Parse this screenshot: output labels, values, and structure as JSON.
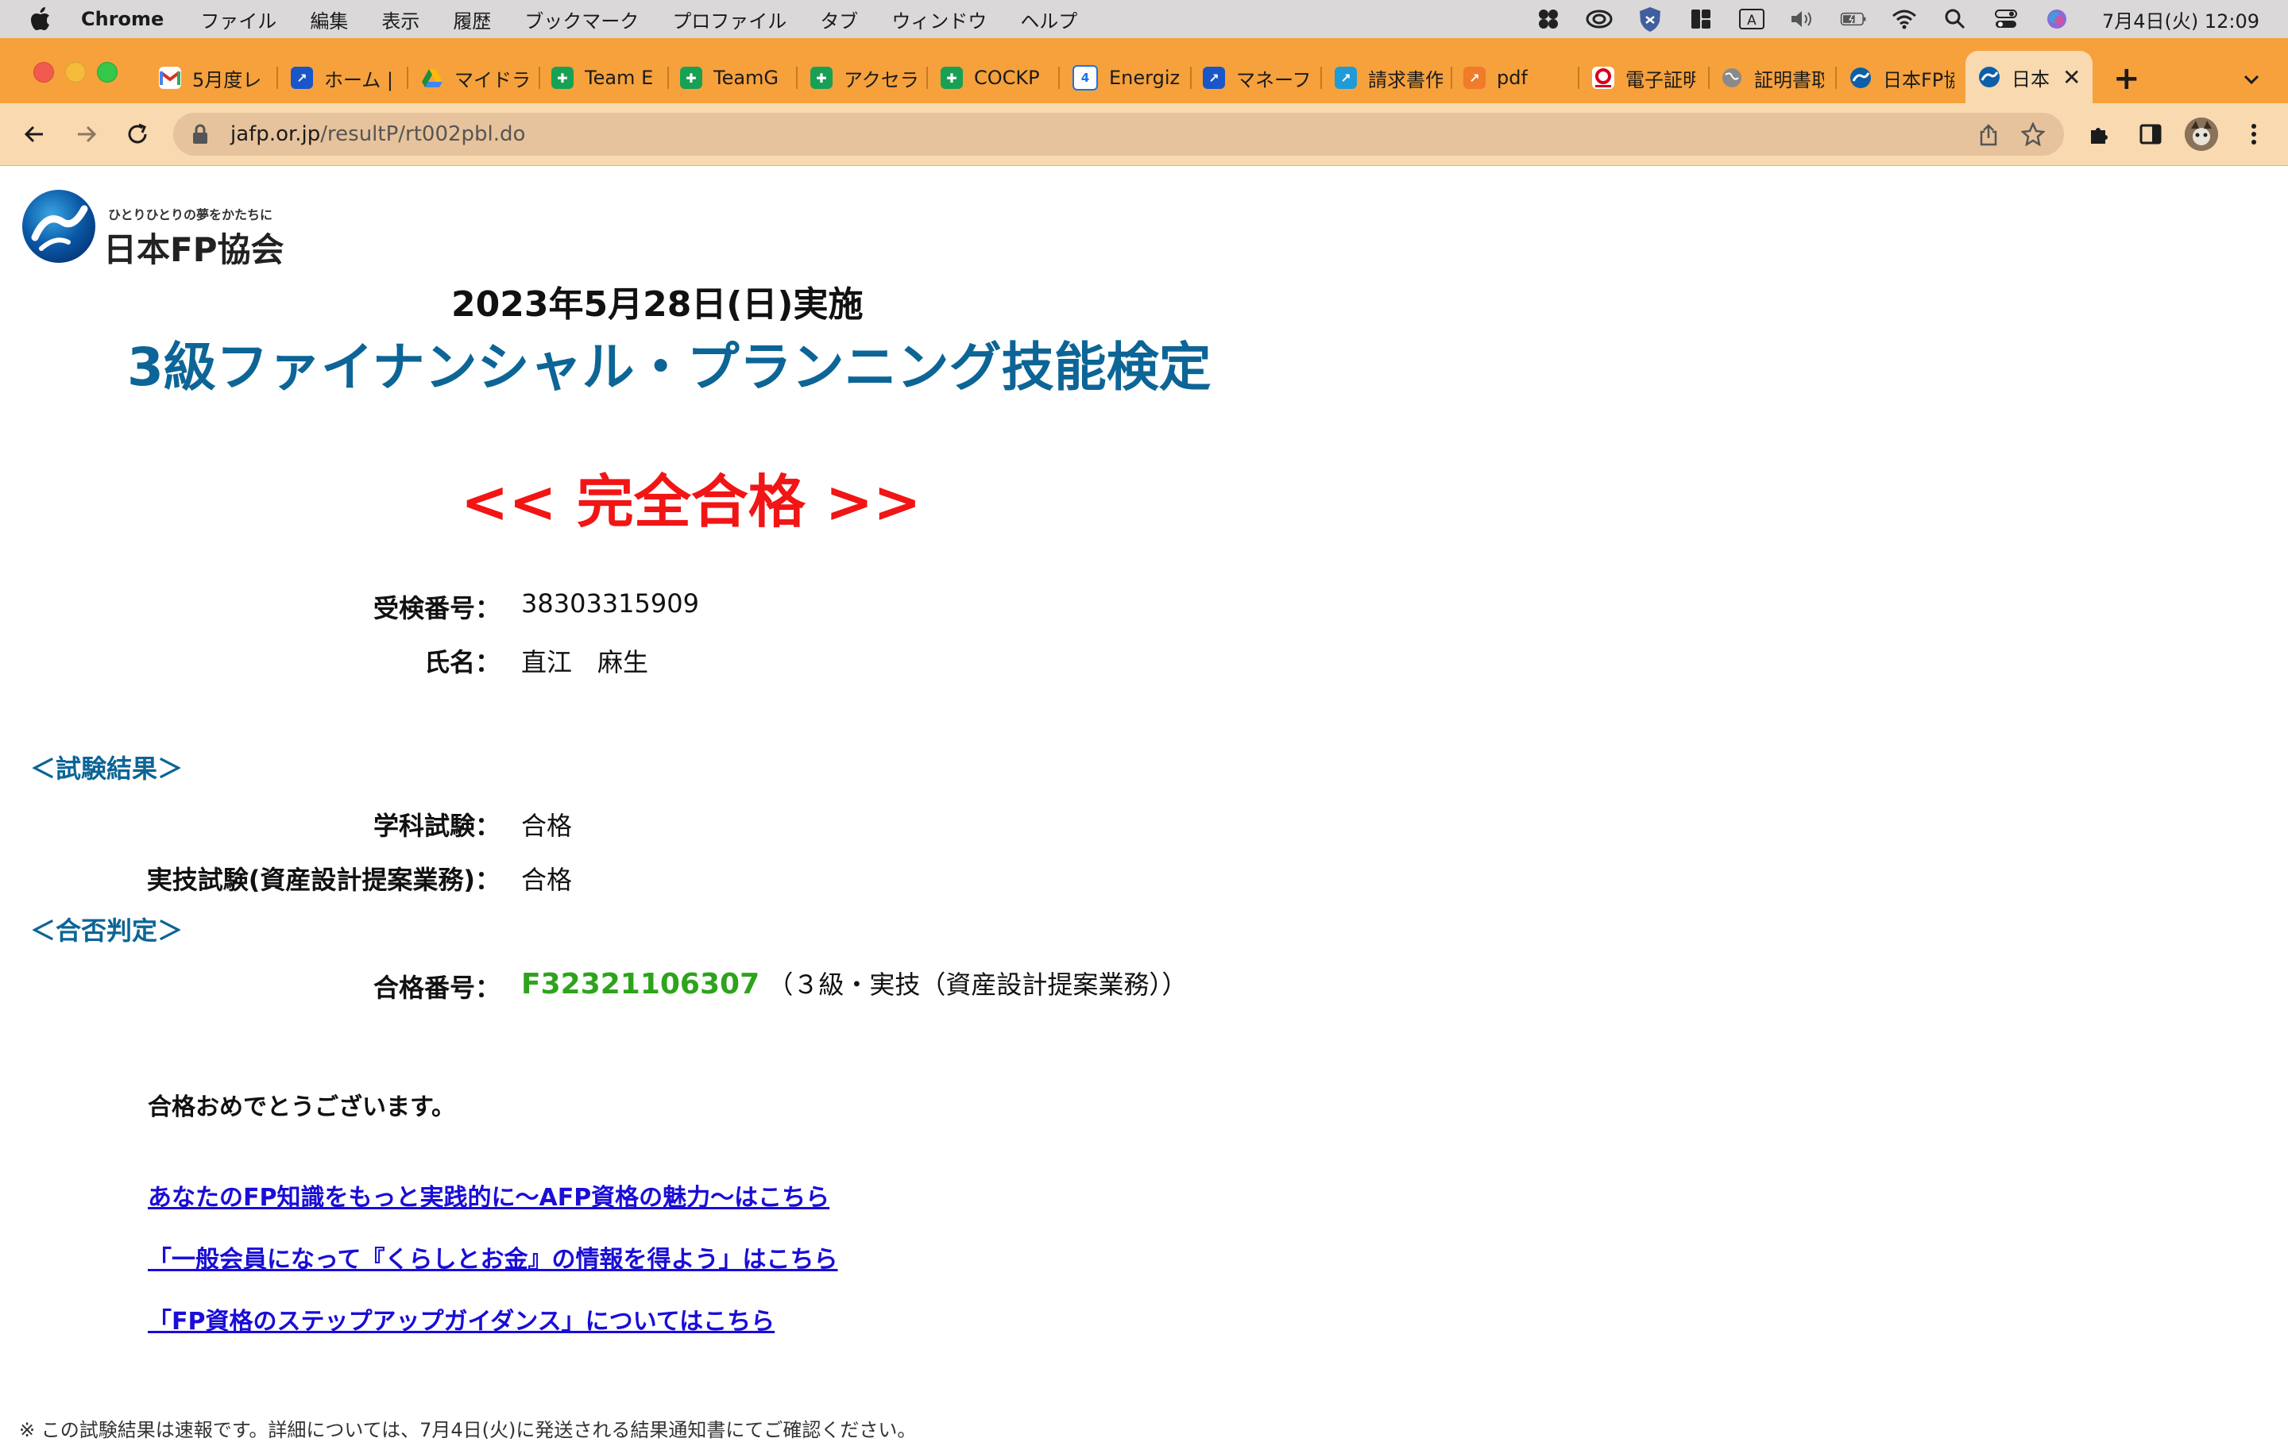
{
  "menubar": {
    "app_name": "Chrome",
    "items": [
      "ファイル",
      "編集",
      "表示",
      "履歴",
      "ブックマーク",
      "プロファイル",
      "タブ",
      "ウィンドウ",
      "ヘルプ"
    ],
    "clock": "7月4日(火)  12:09"
  },
  "tabs": [
    {
      "title": "5月度レ",
      "favicon": "gmail-icon",
      "color": "#d93025"
    },
    {
      "title": "ホーム |",
      "favicon": "chart-icon",
      "color": "#1a56c8"
    },
    {
      "title": "マイドラ",
      "favicon": "drive-icon",
      "color": "#1e8e3e"
    },
    {
      "title": "Team E",
      "favicon": "sheets-icon",
      "color": "#18a055"
    },
    {
      "title": "TeamG",
      "favicon": "sheets-icon",
      "color": "#18a055"
    },
    {
      "title": "アクセラ",
      "favicon": "sheets-icon",
      "color": "#18a055"
    },
    {
      "title": "COCKP",
      "favicon": "sheets-icon",
      "color": "#18a055"
    },
    {
      "title": "Energiz",
      "favicon": "calendar-icon",
      "color": "#1a73e8"
    },
    {
      "title": "マネーフ",
      "favicon": "chart-icon",
      "color": "#1a56c8"
    },
    {
      "title": "請求書作",
      "favicon": "chart-icon",
      "color": "#1f9bd7"
    },
    {
      "title": "pdf",
      "favicon": "chart-icon",
      "color": "#f07b2a"
    },
    {
      "title": "電子証明",
      "favicon": "mufg-icon",
      "color": "#d6001c"
    },
    {
      "title": "証明書取",
      "favicon": "globe-icon",
      "color": "#5f6368"
    },
    {
      "title": "日本FP協",
      "favicon": "jafp-icon",
      "color": "#0c5fa8"
    },
    {
      "title": "日本",
      "favicon": "jafp-icon",
      "color": "#0c5fa8"
    }
  ],
  "address_bar": {
    "host": "jafp.or.jp",
    "path": "/resultP/rt002pbl.do"
  },
  "page": {
    "logo": {
      "tagline": "ひとりひとりの夢をかたちに",
      "name": "日本FP協会"
    },
    "exam_date": "2023年5月28日(日)実施",
    "exam_title": "3級ファイナンシャル・プランニング技能検定",
    "result_banner": "<< 完全合格 >>",
    "examinee": {
      "number_label": "受検番号：",
      "number_value": "38303315909",
      "name_label": "氏名：",
      "name_value": "直江　麻生"
    },
    "results_heading": "＜試験結果＞",
    "results": {
      "written_label": "学科試験：",
      "written_value": "合格",
      "practical_label": "実技試験(資産設計提案業務)：",
      "practical_value": "合格"
    },
    "judgement_heading": "＜合否判定＞",
    "judgement": {
      "pass_label": "合格番号：",
      "pass_number": "F32321106307",
      "pass_note": "（３級・実技（資産設計提案業務））"
    },
    "congrats": "合格おめでとうございます。",
    "links": [
      "あなたのFP知識をもっと実践的に〜AFP資格の魅力〜はこちら",
      "「一般会員になって『くらしとお金』の情報を得よう」はこちら",
      "「FP資格のステップアップガイダンス」についてはこちら"
    ],
    "footnote": "※ この試験結果は速報です。詳細については、7月4日(火)に発送される結果通知書にてご確認ください。"
  },
  "colors": {
    "title_blue": "#0c6596",
    "banner_red": "#f11515",
    "pass_green": "#2ea31c",
    "link_blue": "#1a0dd6",
    "tabstrip": "#f6a13c",
    "toolbar": "#f8d9b0"
  }
}
